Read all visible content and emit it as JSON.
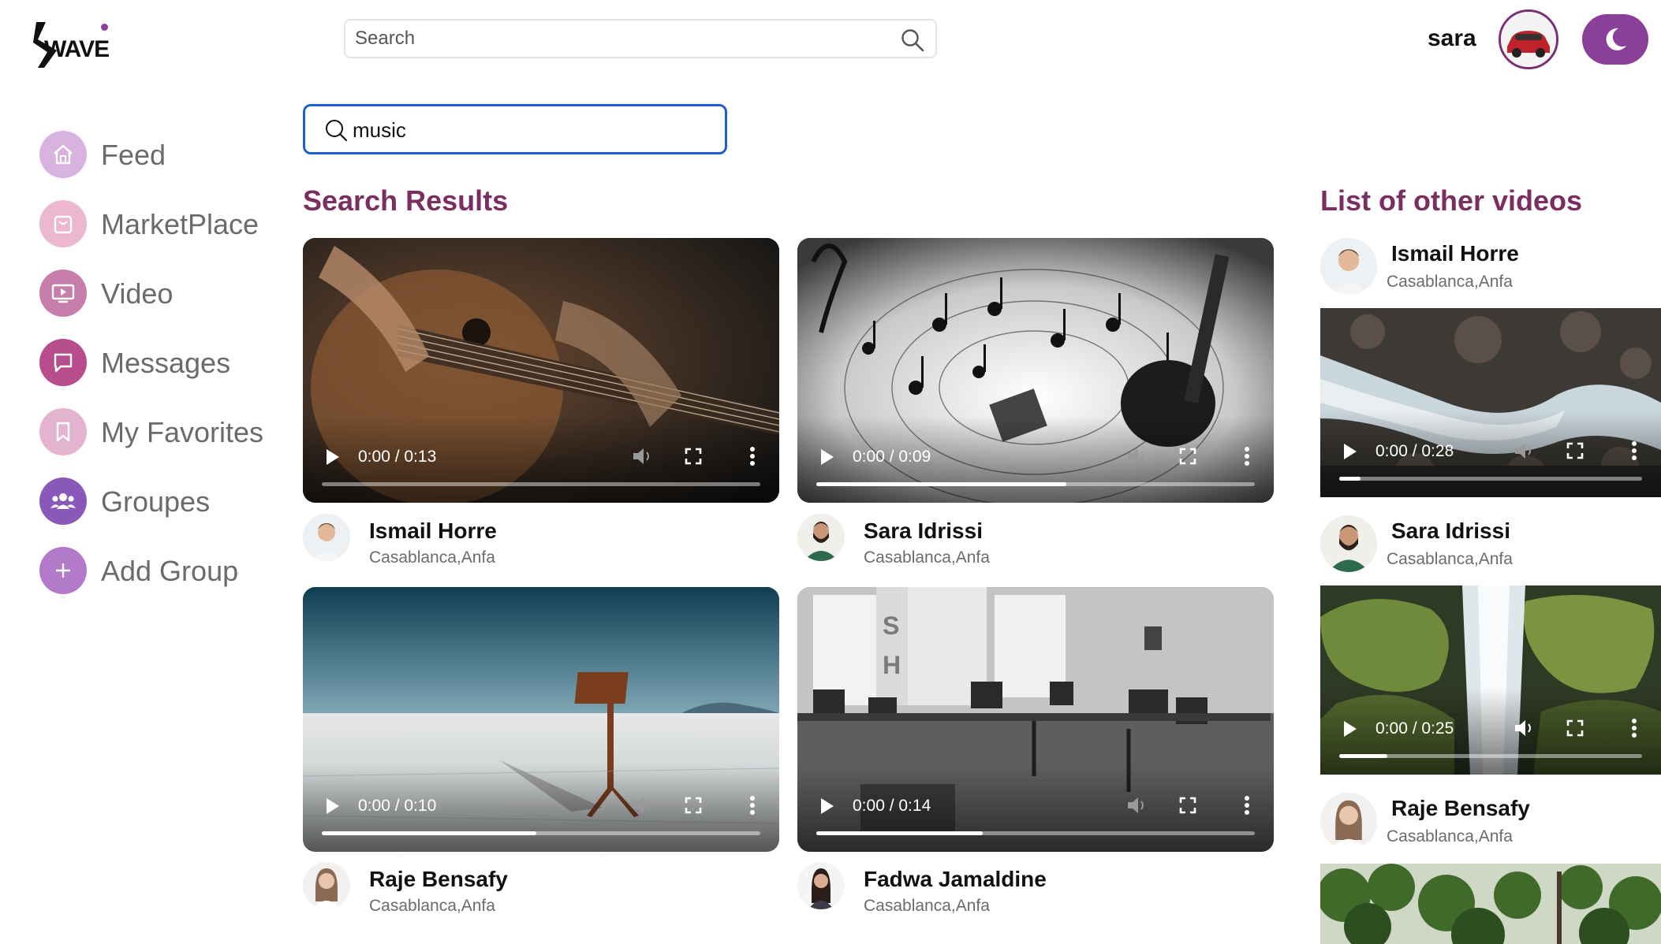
{
  "header": {
    "logo_text": "WAVE",
    "search_placeholder": "Search",
    "user_name": "sara"
  },
  "sidebar": {
    "items": [
      {
        "label": "Feed",
        "icon": "home-icon",
        "color": "#d9b3e0"
      },
      {
        "label": "MarketPlace",
        "icon": "shopping-bag-icon",
        "color": "#ebb8cf"
      },
      {
        "label": "Video",
        "icon": "tv-icon",
        "color": "#c67eaa"
      },
      {
        "label": "Messages",
        "icon": "chat-icon",
        "color": "#b84d8d"
      },
      {
        "label": "My Favorites",
        "icon": "bookmark-icon",
        "color": "#e4b3cf"
      },
      {
        "label": "Groupes",
        "icon": "users-icon",
        "color": "#8a58b8"
      },
      {
        "label": "Add Group",
        "icon": "plus-icon",
        "color": "#b27ac8"
      }
    ]
  },
  "search": {
    "value": "music"
  },
  "results": {
    "title": "Search Results",
    "videos": [
      {
        "time": "0:00 / 0:13",
        "progress": 0.0,
        "author": "Ismail Horre",
        "location": "Casablanca,Anfa"
      },
      {
        "time": "0:00 / 0:09",
        "progress": 0.57,
        "author": "Sara Idrissi",
        "location": "Casablanca,Anfa"
      },
      {
        "time": "0:00 / 0:10",
        "progress": 0.49,
        "author": "Raje Bensafy",
        "location": "Casablanca,Anfa"
      },
      {
        "time": "0:00 / 0:14",
        "progress": 0.38,
        "author": "Fadwa Jamaldine",
        "location": "Casablanca,Anfa"
      }
    ]
  },
  "other": {
    "title": "List of other videos",
    "videos": [
      {
        "author": "Ismail Horre",
        "location": "Casablanca,Anfa",
        "time": "0:00 / 0:28",
        "progress": 0.07
      },
      {
        "author": "Sara Idrissi",
        "location": "Casablanca,Anfa",
        "time": "0:00 / 0:25",
        "progress": 0.16
      },
      {
        "author": "Raje Bensafy",
        "location": "Casablanca,Anfa"
      }
    ]
  },
  "colors": {
    "accent": "#8a3f99",
    "title": "#7b2f61",
    "focus": "#1f5fd6"
  }
}
